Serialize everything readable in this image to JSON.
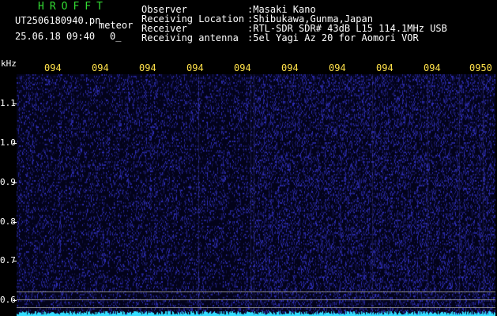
{
  "header": {
    "app_title": "HROFFT",
    "file_name": "UT2506180940.pn",
    "detector": "meteor",
    "datetime": "25.06.18 09:40",
    "count": "0_"
  },
  "info": [
    {
      "label": "Observer",
      "value": ":Masaki Kano"
    },
    {
      "label": "Receiving Location",
      "value": ":Shibukawa,Gunma,Japan"
    },
    {
      "label": "Receiver",
      "value": ":RTL-SDR SDR# 43dB L15 114.1MHz USB"
    },
    {
      "label": "Receiving antenna",
      "value": ":5el Yagi Az 20 for Aomori VOR"
    }
  ],
  "axis": {
    "unit": "kHz",
    "time_ticks": [
      "094",
      "094",
      "094",
      "094",
      "094",
      "094",
      "094",
      "094",
      "094",
      "0950"
    ],
    "freq_ticks": [
      "1.1",
      "1.0",
      "0.9",
      "0.8",
      "0.7",
      "0.6"
    ]
  },
  "colors": {
    "time_label": "#ffe14a",
    "title": "#33dd33",
    "baseline": "#33ddff",
    "background": "#000000"
  }
}
